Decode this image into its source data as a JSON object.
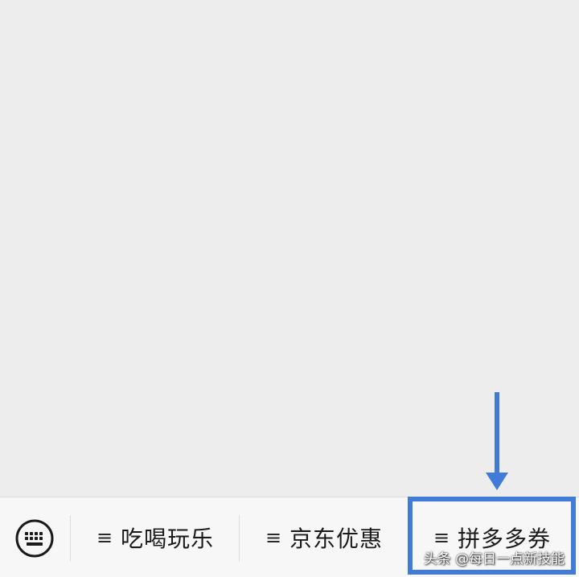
{
  "menu_bar": {
    "keyboard_icon": "keyboard-icon",
    "items": [
      {
        "icon": "menu-lines-icon",
        "glyph": "≡",
        "label": "吃喝玩乐"
      },
      {
        "icon": "menu-lines-icon",
        "glyph": "≡",
        "label": "京东优惠"
      },
      {
        "icon": "menu-lines-icon",
        "glyph": "≡",
        "label": "拼多多券"
      }
    ]
  },
  "annotation": {
    "color": "#3f7bd7",
    "arrow_icon": "down-arrow-icon",
    "highlighted_item": "拼多多券"
  },
  "watermark": {
    "text": "头条 @每日一点新技能"
  },
  "colors": {
    "background": "#ededed",
    "menu_bar": "#f7f7f7",
    "accent": "#3f7bd7"
  }
}
